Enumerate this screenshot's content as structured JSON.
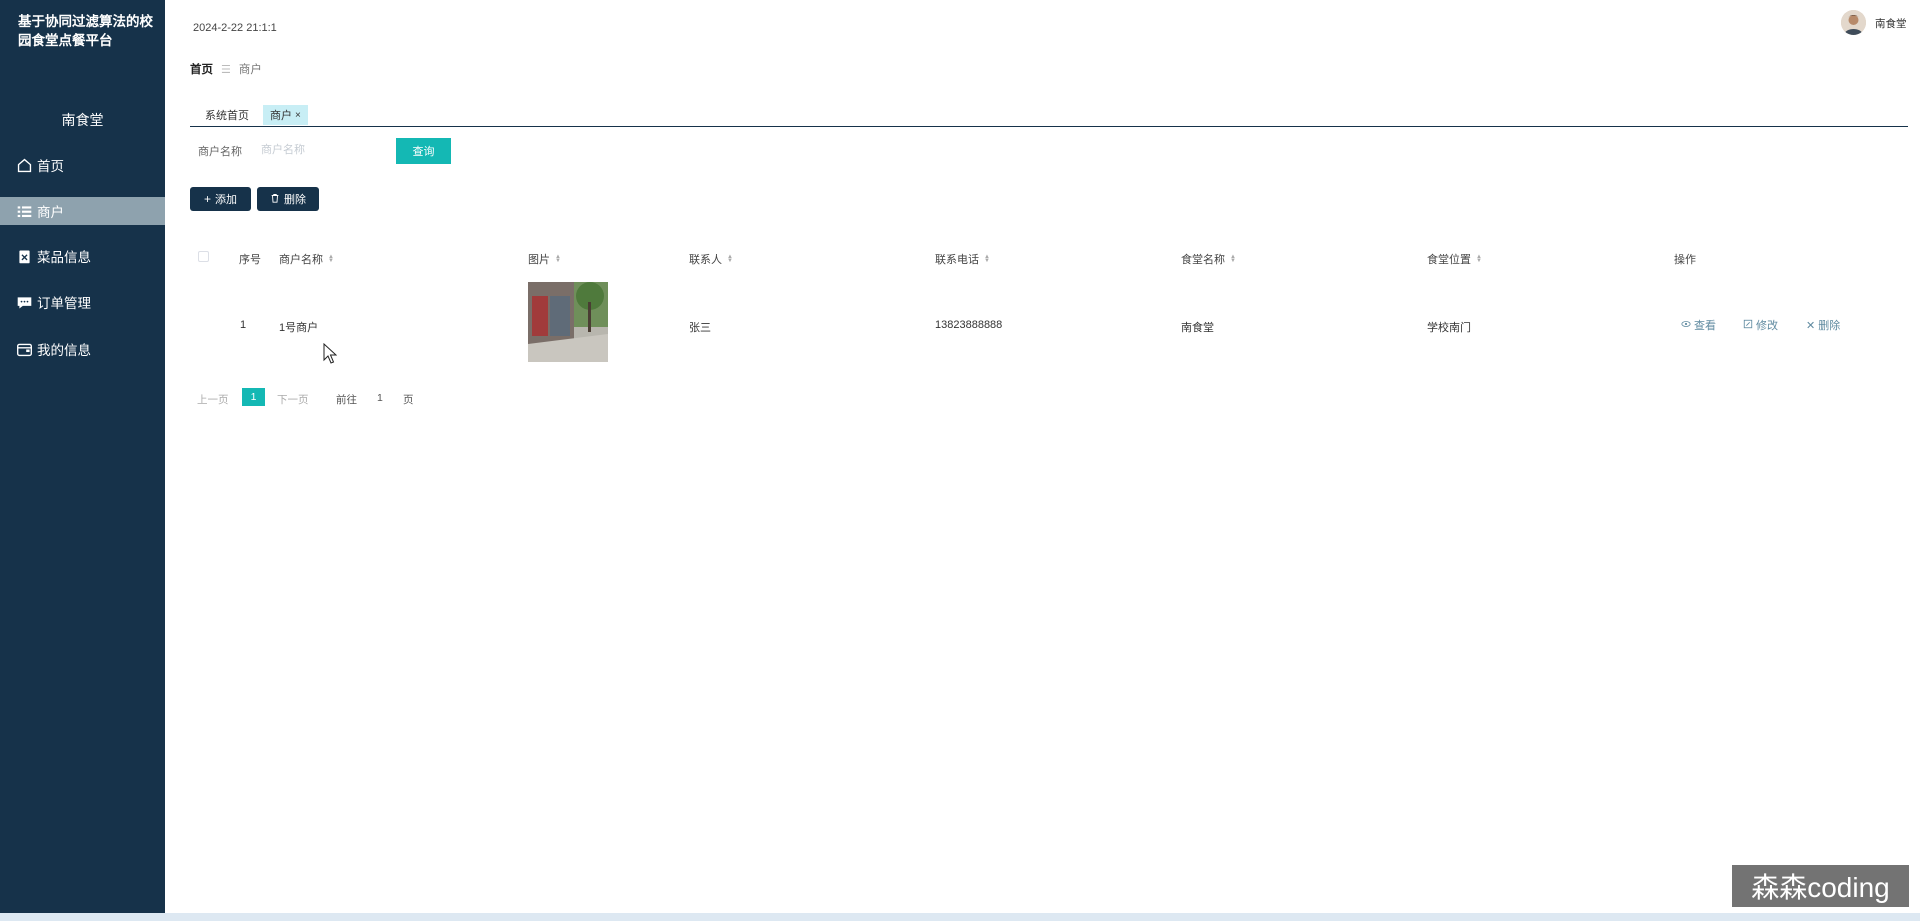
{
  "sidebar": {
    "brand": "基于协同过滤算法的校园食堂点餐平台",
    "user": "南食堂",
    "items": [
      {
        "label": "首页",
        "icon": "home-icon"
      },
      {
        "label": "商户",
        "icon": "list-icon"
      },
      {
        "label": "菜品信息",
        "icon": "clipboard-icon"
      },
      {
        "label": "订单管理",
        "icon": "chat-icon"
      },
      {
        "label": "我的信息",
        "icon": "wallet-icon"
      }
    ]
  },
  "header": {
    "datetime": "2024-2-22 21:1:1",
    "username": "南食堂"
  },
  "breadcrumb": {
    "home": "首页",
    "separator": "☰",
    "current": "商户"
  },
  "tabs": [
    {
      "label": "系统首页"
    },
    {
      "label": "商户",
      "close": "×"
    }
  ],
  "search": {
    "label": "商户名称",
    "placeholder": "商户名称",
    "button": "查询"
  },
  "actions": {
    "add": "添加",
    "delete": "删除"
  },
  "table": {
    "columns": [
      "序号",
      "商户名称",
      "图片",
      "联系人",
      "联系电话",
      "食堂名称",
      "食堂位置",
      "操作"
    ],
    "rows": [
      {
        "index": "1",
        "name": "1号商户",
        "contact": "张三",
        "phone": "13823888888",
        "canteen": "南食堂",
        "location": "学校南门"
      }
    ],
    "ops": {
      "view": "查看",
      "edit": "修改",
      "delete": "删除"
    }
  },
  "pagination": {
    "prev": "上一页",
    "current": "1",
    "next": "下一页",
    "goto": "前往",
    "page_input": "1",
    "page_unit": "页"
  },
  "watermark": "森森coding",
  "colors": {
    "sidebar": "#16324a",
    "active_menu": "#8ea2ae",
    "accent": "#14b8b4",
    "link": "#5f8aa0"
  }
}
